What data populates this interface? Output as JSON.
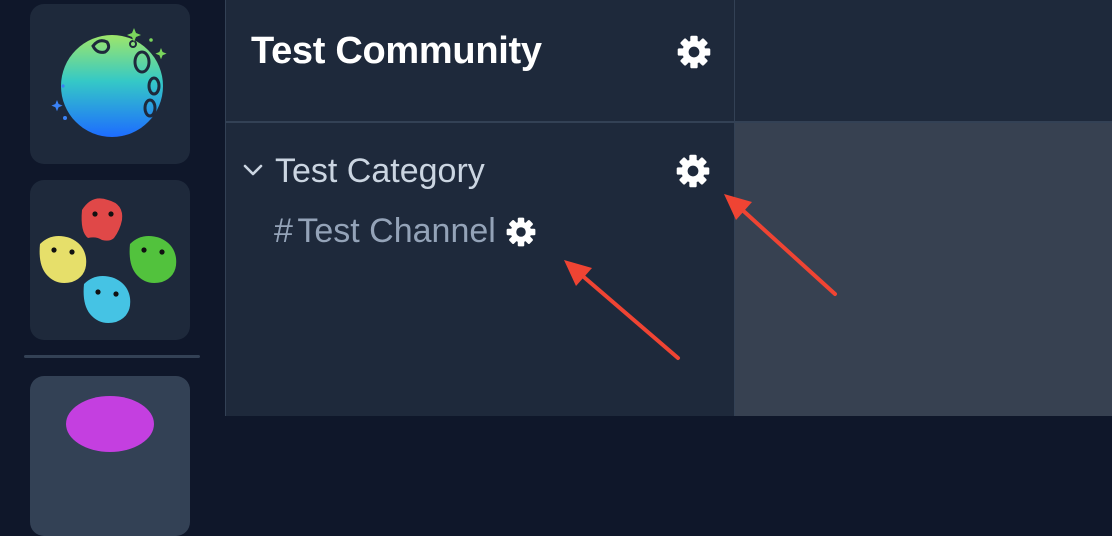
{
  "servers": [
    {
      "icon": "planet-logo-icon",
      "selected": false
    },
    {
      "icon": "colorful-blobs-icon",
      "selected": false
    },
    {
      "icon": "purple-blob-icon",
      "selected": true
    }
  ],
  "community": {
    "title": "Test Community",
    "settings_icon": "gear-icon"
  },
  "category": {
    "label": "Test Category",
    "expanded": true,
    "toggle_icon": "chevron-down-icon",
    "settings_icon": "gear-icon"
  },
  "channel": {
    "prefix": "#",
    "label": "Test Channel",
    "settings_icon": "gear-icon"
  },
  "annotations": {
    "arrow_color": "#ef4433"
  },
  "colors": {
    "rail_bg": "#0f172a",
    "panel_bg": "#1e293b",
    "content_bg": "#374151",
    "border": "#334155"
  }
}
